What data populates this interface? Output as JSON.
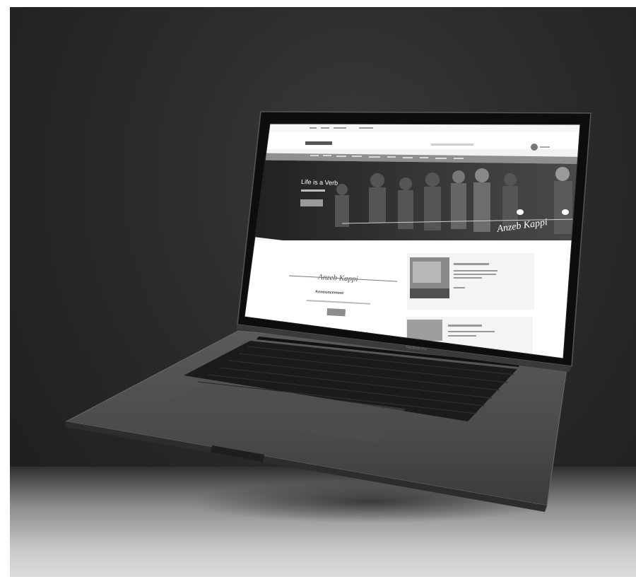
{
  "hero": {
    "headline": "Life is a Verb",
    "signature": "Anzeb Kappi"
  },
  "feature": {
    "heading": "Announcement",
    "signature": "Anzeb Kappi"
  },
  "laptop": {
    "brand": "MacBook Pro"
  },
  "colors": {
    "background": "#262626",
    "screen_nav": "#8f8f8f",
    "hero_dark": "#2c2c2c",
    "floor": "#cfcfcf"
  }
}
